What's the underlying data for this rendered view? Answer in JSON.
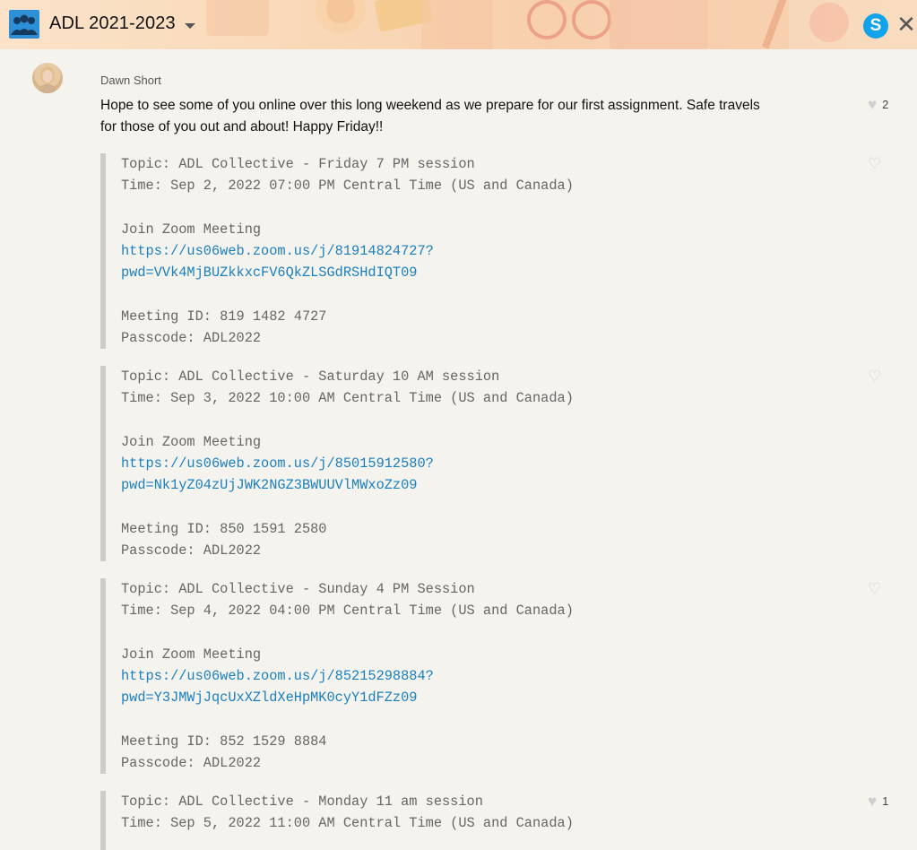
{
  "header": {
    "title": "ADL 2021-2023",
    "group_icon": "group-avatar-icon",
    "skype_icon_letter": "S",
    "close_glyph": "✕",
    "accent": "#12a3ea"
  },
  "message": {
    "sender": "Dawn Short",
    "text": "Hope to see some of you online over this long weekend as we prepare for our first assignment. Safe travels for those of you out and about! Happy Friday!!",
    "likes": "2"
  },
  "quotes": [
    {
      "topic": "Topic: ADL Collective - Friday 7 PM session",
      "time": "Time: Sep 2, 2022 07:00 PM Central Time (US and Canada)",
      "join": "Join Zoom Meeting",
      "link1": "https://us06web.zoom.us/j/81914824727?",
      "link2": "pwd=VVk4MjBUZkkxcFV6QkZLSGdRSHdIQT09",
      "meeting_id": "Meeting ID: 819 1482 4727",
      "passcode": "Passcode: ADL2022",
      "likes": ""
    },
    {
      "topic": "Topic: ADL Collective - Saturday 10 AM session",
      "time": "Time: Sep 3, 2022 10:00 AM Central Time (US and Canada)",
      "join": "Join Zoom Meeting",
      "link1": "https://us06web.zoom.us/j/85015912580?",
      "link2": "pwd=Nk1yZ04zUjJWK2NGZ3BWUUVlMWxoZz09",
      "meeting_id": "Meeting ID: 850 1591 2580",
      "passcode": "Passcode: ADL2022",
      "likes": ""
    },
    {
      "topic": "Topic: ADL Collective - Sunday 4 PM Session",
      "time": "Time: Sep 4, 2022 04:00 PM Central Time (US and Canada)",
      "join": "Join Zoom Meeting",
      "link1": "https://us06web.zoom.us/j/85215298884?",
      "link2": "pwd=Y3JMWjJqcUxXZldXeHpMK0cyY1dFZz09",
      "meeting_id": "Meeting ID: 852 1529 8884",
      "passcode": "Passcode: ADL2022",
      "likes": ""
    },
    {
      "topic": "Topic: ADL Collective - Monday 11 am session",
      "time": "Time: Sep 5, 2022 11:00 AM Central Time (US and Canada)",
      "likes": "1"
    }
  ]
}
